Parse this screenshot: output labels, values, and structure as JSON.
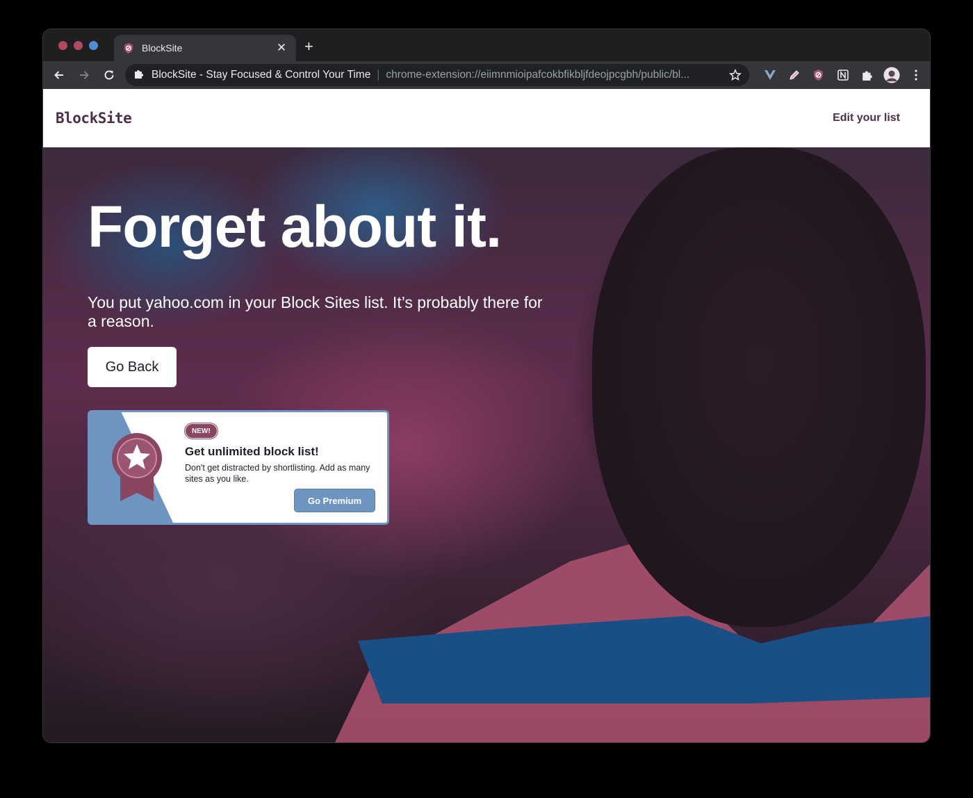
{
  "browser": {
    "tab": {
      "title": "BlockSite"
    },
    "new_tab_symbol": "+",
    "omnibox": {
      "page_title": "BlockSite - Stay Focused & Control Your Time",
      "url": "chrome-extension://eiimnmioipafcokbfikbljfdeojpcgbh/public/bl..."
    }
  },
  "site": {
    "logo": "BlockSite",
    "edit_link": "Edit your list"
  },
  "hero": {
    "title": "Forget about it.",
    "subtitle": "You put yahoo.com in your Block Sites list. It’s probably there for a reason.",
    "go_back_label": "Go Back"
  },
  "promo": {
    "badge": "NEW!",
    "title": "Get unlimited block list!",
    "description": "Don't get distracted by shortlisting. Add as many sites as you like.",
    "cta_label": "Go Premium"
  },
  "colors": {
    "brand": "#4d2f4a",
    "accent_blue": "#6e94c0",
    "badge": "#8a4560"
  },
  "icons": [
    "back-arrow-icon",
    "forward-arrow-icon",
    "reload-icon",
    "extension-puzzle-icon",
    "star-icon",
    "vue-devtools-icon",
    "pen-icon",
    "blocksite-shield-icon",
    "notion-icon",
    "extensions-icon",
    "profile-avatar",
    "kebab-menu-icon",
    "award-ribbon-icon"
  ]
}
